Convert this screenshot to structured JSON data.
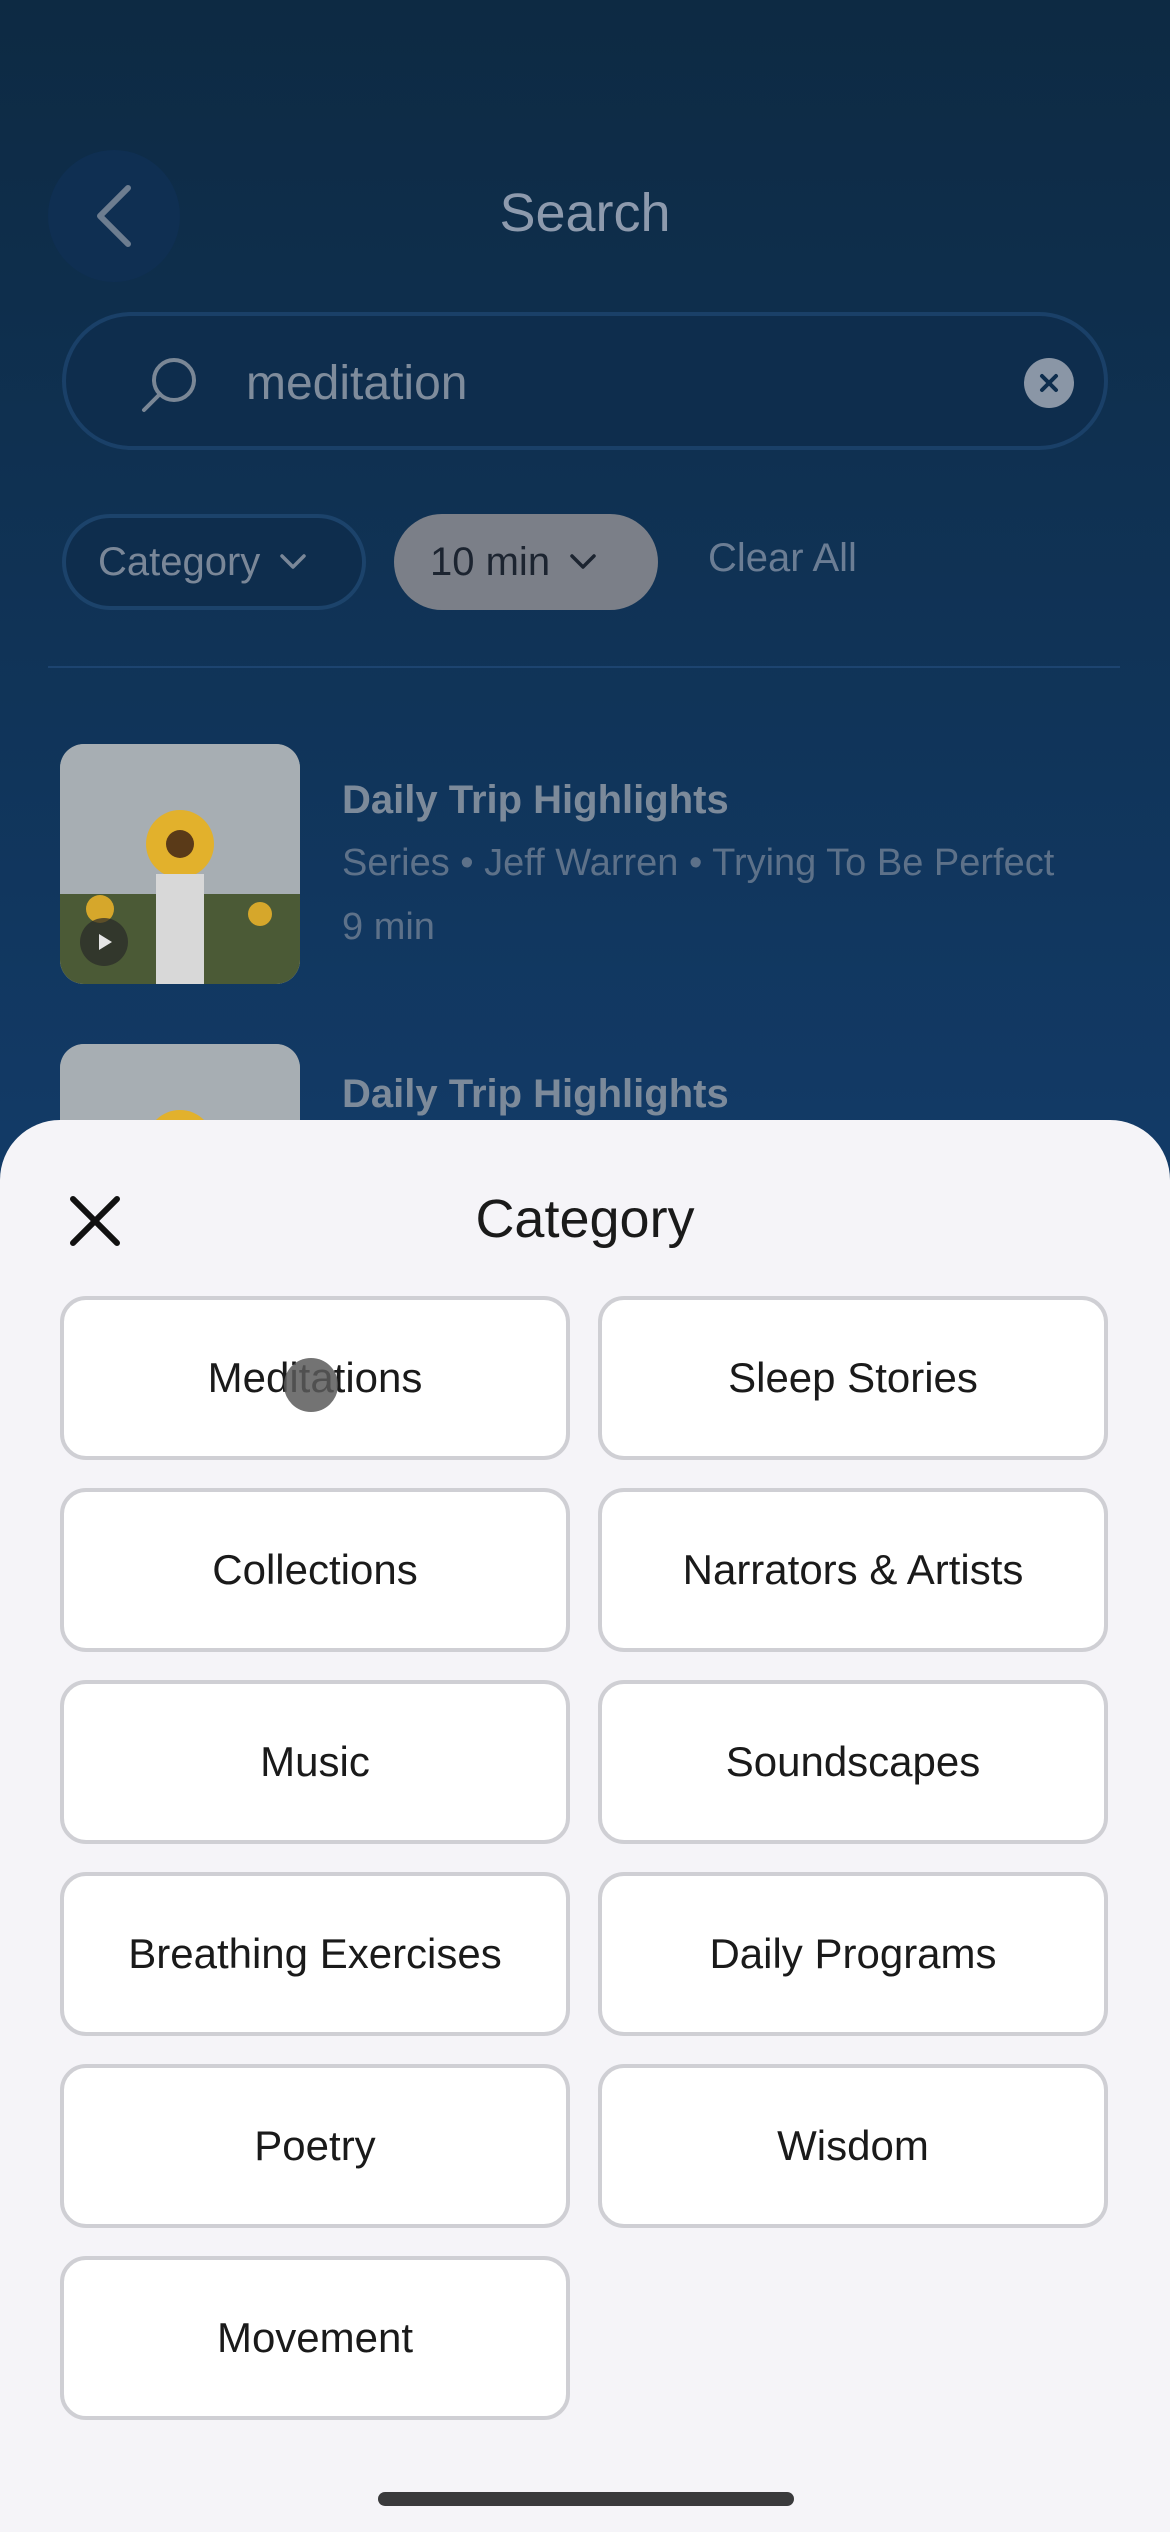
{
  "header": {
    "title": "Search"
  },
  "search": {
    "value": "meditation"
  },
  "filters": {
    "category_label": "Category",
    "time_label": "10 min",
    "clear_all_label": "Clear All"
  },
  "results": [
    {
      "title": "Daily Trip Highlights",
      "meta": "Series • Jeff Warren • Trying To Be Perfect",
      "duration": "9 min"
    },
    {
      "title": "Daily Trip Highlights"
    }
  ],
  "sheet": {
    "title": "Category",
    "categories": [
      "Meditations",
      "Sleep Stories",
      "Collections",
      "Narrators & Artists",
      "Music",
      "Soundscapes",
      "Breathing Exercises",
      "Daily Programs",
      "Poetry",
      "Wisdom",
      "Movement"
    ]
  },
  "icons": {
    "back": "chevron-left-icon",
    "search": "search-icon",
    "clear": "clear-icon",
    "chevron": "chevron-down-icon",
    "close": "close-icon",
    "play": "play-icon"
  },
  "colors": {
    "background_top": "#0d2a43",
    "background_bottom": "#144075",
    "sheet": "#f5f4f8",
    "selected_chip": "#7b7f88"
  }
}
